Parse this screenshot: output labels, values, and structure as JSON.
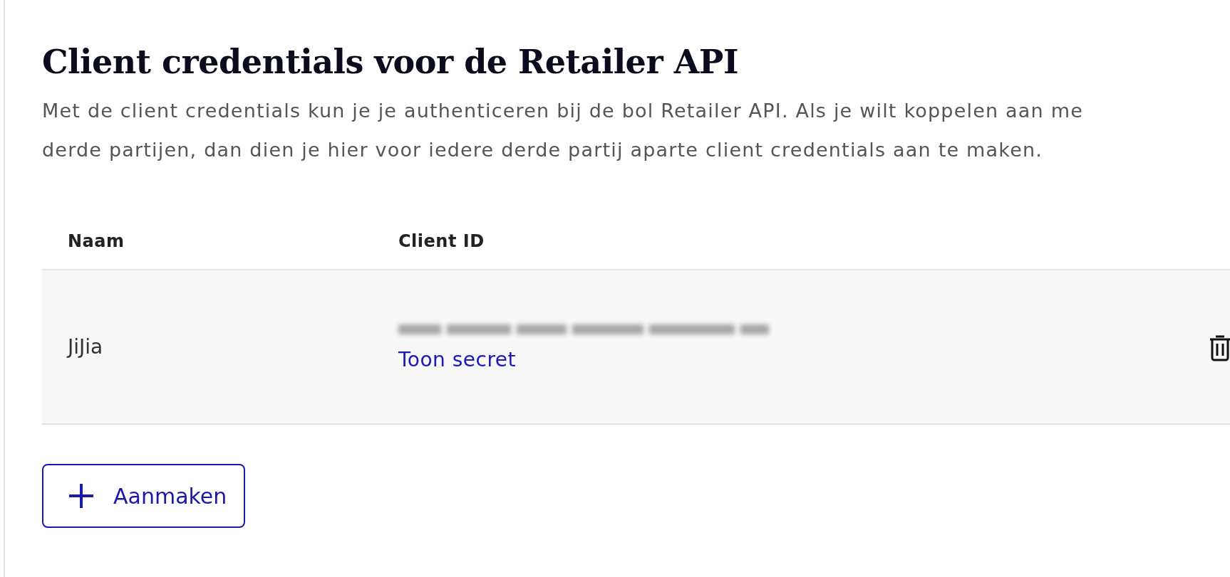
{
  "title": "Client credentials voor de Retailer API",
  "description": "Met de client credentials kun je je authenticeren bij de bol Retailer API. Als je wilt koppelen aan me\nderde partijen, dan dien je hier voor iedere derde partij aparte client credentials aan te maken.",
  "table": {
    "columns": [
      "Naam",
      "Client ID"
    ],
    "rows": [
      {
        "name": "JiJia",
        "client_id_blurred": true,
        "secret_link": "Toon secret",
        "delete": true
      }
    ]
  },
  "create_button": {
    "label": "Aanmaken"
  }
}
